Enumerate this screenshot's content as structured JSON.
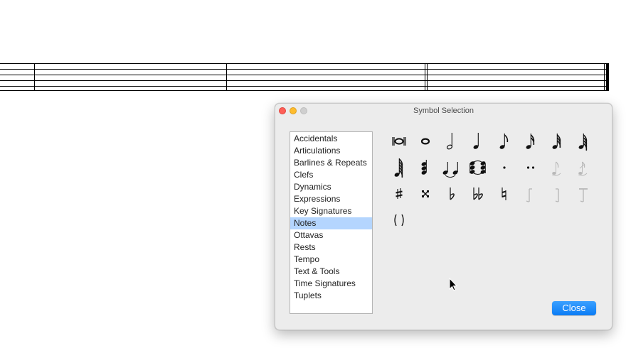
{
  "dialog": {
    "title": "Symbol Selection",
    "close_label": "Close",
    "selected_category": "Notes",
    "categories": [
      "Accidentals",
      "Articulations",
      "Barlines & Repeats",
      "Clefs",
      "Dynamics",
      "Expressions",
      "Key Signatures",
      "Notes",
      "Ottavas",
      "Rests",
      "Tempo",
      "Text & Tools",
      "Time Signatures",
      "Tuplets"
    ],
    "symbols": [
      {
        "icon": "breve-icon",
        "row": 0,
        "col": 0,
        "enabled": true
      },
      {
        "icon": "whole-note-icon",
        "row": 0,
        "col": 1,
        "enabled": true
      },
      {
        "icon": "half-note-icon",
        "row": 0,
        "col": 2,
        "enabled": true
      },
      {
        "icon": "quarter-note-icon",
        "row": 0,
        "col": 3,
        "enabled": true
      },
      {
        "icon": "eighth-note-icon",
        "row": 0,
        "col": 4,
        "enabled": true
      },
      {
        "icon": "sixteenth-note-icon",
        "row": 0,
        "col": 5,
        "enabled": true
      },
      {
        "icon": "thirty-second-note-icon",
        "row": 0,
        "col": 6,
        "enabled": true
      },
      {
        "icon": "sixty-fourth-note-icon",
        "row": 0,
        "col": 7,
        "enabled": true
      },
      {
        "icon": "hundred-twenty-eighth-note-icon",
        "row": 1,
        "col": 0,
        "enabled": true
      },
      {
        "icon": "chord-icon",
        "row": 1,
        "col": 1,
        "enabled": true
      },
      {
        "icon": "tied-notes-icon",
        "row": 1,
        "col": 2,
        "enabled": true
      },
      {
        "icon": "tied-chord-icon",
        "row": 1,
        "col": 3,
        "enabled": true
      },
      {
        "icon": "dot-icon",
        "row": 1,
        "col": 4,
        "enabled": true
      },
      {
        "icon": "double-dot-icon",
        "row": 1,
        "col": 5,
        "enabled": true
      },
      {
        "icon": "grace-note-icon",
        "row": 1,
        "col": 6,
        "enabled": false
      },
      {
        "icon": "acciaccatura-icon",
        "row": 1,
        "col": 7,
        "enabled": false
      },
      {
        "icon": "sharp-icon",
        "row": 2,
        "col": 0,
        "enabled": true
      },
      {
        "icon": "double-sharp-icon",
        "row": 2,
        "col": 1,
        "enabled": true
      },
      {
        "icon": "flat-icon",
        "row": 2,
        "col": 2,
        "enabled": true
      },
      {
        "icon": "double-flat-icon",
        "row": 2,
        "col": 3,
        "enabled": true
      },
      {
        "icon": "natural-icon",
        "row": 2,
        "col": 4,
        "enabled": true
      },
      {
        "icon": "stem-flag-left-icon",
        "row": 2,
        "col": 5,
        "enabled": false
      },
      {
        "icon": "stem-flag-right-icon",
        "row": 2,
        "col": 6,
        "enabled": false
      },
      {
        "icon": "stem-beam-icon",
        "row": 2,
        "col": 7,
        "enabled": false
      },
      {
        "icon": "parentheses-icon",
        "row": 3,
        "col": 0,
        "enabled": true
      }
    ]
  },
  "colors": {
    "selection": "#b4d5fe",
    "button": "#0a7cf5",
    "symbol": "#111111",
    "symbol_disabled": "#b8b8b8"
  }
}
